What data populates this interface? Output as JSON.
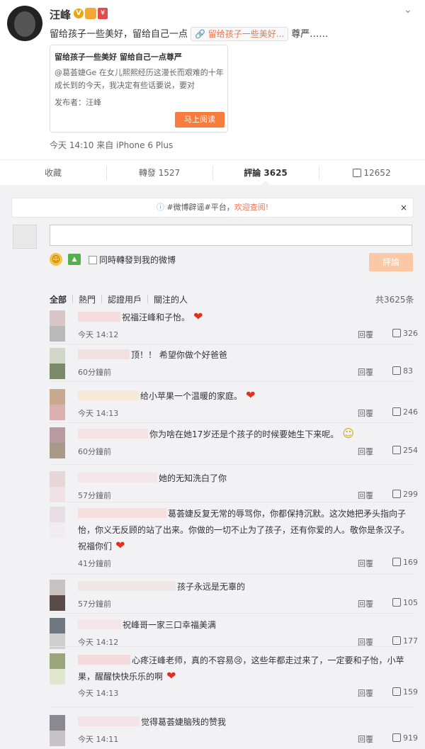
{
  "post": {
    "username": "汪峰",
    "text_before_link": "留给孩子一些美好，留给自己一点",
    "link_label": "留给孩子一些美好...",
    "text_after_link": "尊严……",
    "card": {
      "title": "留给孩子一些美好 留给自己一点尊严",
      "desc": "@葛荟婕Ge 在女儿熙熙经历这漫长而艰难的十年成长到的今天，我决定有些话要说，要对",
      "publisher": "发布者：汪峰",
      "button": "马上阅读"
    },
    "meta": "今天 14:10 来自 iPhone 6 Plus"
  },
  "actions": {
    "favorite": "收藏",
    "repost": "轉發 1527",
    "comment": "評論 3625",
    "like": "12652"
  },
  "notice": {
    "prefix": "#微博辟谣#平台，",
    "link": "欢迎查阅!",
    "close": "×"
  },
  "composer": {
    "sync_label": "同時轉發到我的微博",
    "submit": "評論"
  },
  "filters": {
    "all": "全部",
    "hot": "熱門",
    "verified": "認證用戶",
    "following": "關注的人",
    "total": "共3625条"
  },
  "reply_label": "回覆",
  "comments": [
    {
      "text": "祝福汪峰和子怡。",
      "time": "今天 14:12",
      "likes": "326",
      "emoji": "heart"
    },
    {
      "text": "顶！！ 希望你做个好爸爸",
      "time": "60分鐘前",
      "likes": "83",
      "emoji": ""
    },
    {
      "text": "给小苹果一个温暖的家庭。",
      "time": "今天 14:13",
      "likes": "246",
      "emoji": "heart"
    },
    {
      "text": "你为啥在她17岁还是个孩子的时候要她生下来呢。",
      "time": "60分鐘前",
      "likes": "254",
      "emoji": "smile"
    },
    {
      "text": "她的无知洗白了你",
      "time": "57分鐘前",
      "likes": "299",
      "emoji": ""
    },
    {
      "text": "葛荟婕反复无常的辱骂你，你都保持沉默。这次她把矛头指向子怡，你义无反顾的站了出来。你做的一切不止为了孩子，还有你爱的人。敬你是条汉子。祝福你们",
      "time": "41分鐘前",
      "likes": "169",
      "emoji": "heart"
    },
    {
      "text": "孩子永远是无辜的",
      "time": "57分鐘前",
      "likes": "105",
      "emoji": ""
    },
    {
      "text": "祝峰哥一家三口幸福美满",
      "time": "今天 14:12",
      "likes": "177",
      "emoji": ""
    },
    {
      "text": "心疼汪峰老师，真的不容易😢，这些年都走过来了，一定要和子怡，小苹果，醒醒快快乐乐的啊",
      "time": "今天 14:13",
      "likes": "159",
      "emoji": "heart"
    },
    {
      "text": "觉得葛荟婕脑残的赞我",
      "time": "今天 14:11",
      "likes": "919",
      "emoji": ""
    }
  ]
}
